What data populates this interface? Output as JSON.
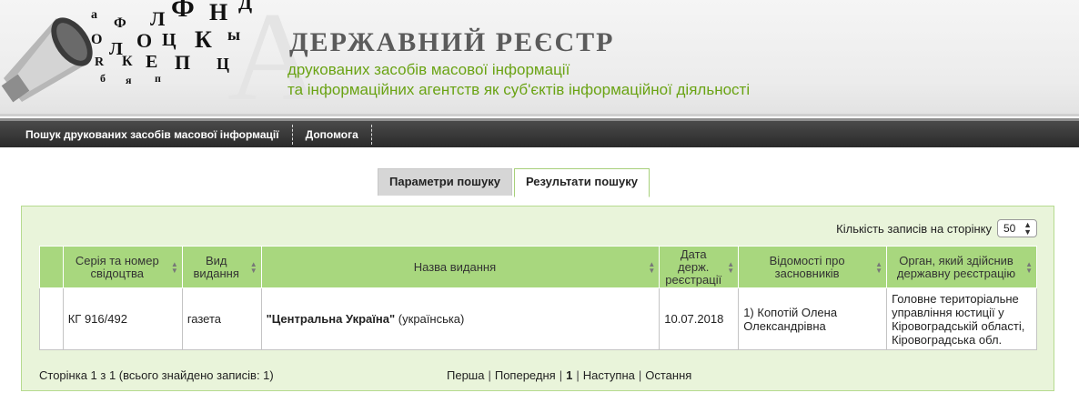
{
  "header": {
    "title": "ДЕРЖАВНИЙ   РЕЄСТР",
    "subtitle_1": "друкованих засобів масової інформації",
    "subtitle_2": "та інформаційних агентств як суб'єктів інформаційної діяльності"
  },
  "nav": {
    "items": [
      "Пошук друкованих засобів масової інформації",
      "Допомога"
    ]
  },
  "tabs": {
    "search_params": "Параметри пошуку",
    "search_results": "Результати пошуку"
  },
  "perpage": {
    "label": "Кількість записів на сторінку",
    "value": "50"
  },
  "table": {
    "headers": [
      "Серія та номер свідоцтва",
      "Вид видання",
      "Назва видання",
      "Дата держ. реєстрації",
      "Відомості про засновників",
      "Орган, який здійснив державну реєстрацію"
    ],
    "rows": [
      {
        "number": "КГ 916/492",
        "type": "газета",
        "name": "\"Центральна Україна\"",
        "lang": "(українська)",
        "date": "10.07.2018",
        "founders": "1) Копотій Олена Олександрівна",
        "authority": "Головне територіальне управління юстиції у Кіровоградській області, Кіровоградська обл."
      }
    ]
  },
  "footer": {
    "info": "Сторінка 1 з 1 (всього знайдено записів: 1)",
    "pager": {
      "first": "Перша",
      "prev": "Попередня",
      "current": "1",
      "next": "Наступна",
      "last": "Остання"
    }
  }
}
